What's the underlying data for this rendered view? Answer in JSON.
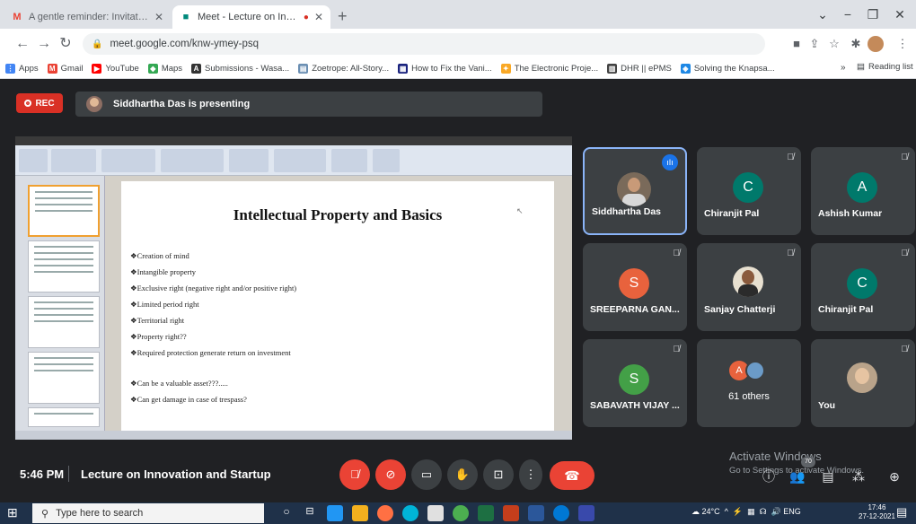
{
  "browser": {
    "tabs": [
      {
        "title": "A gentle reminder: Invitation for",
        "icon": "gmail-icon",
        "active": false
      },
      {
        "title": "Meet - Lecture on Innovation",
        "icon": "meet-icon",
        "active": true
      }
    ],
    "new_tab": "+",
    "address": "meet.google.com/knw-ymey-psq",
    "bookmarks": [
      {
        "label": "Apps",
        "color": "#4285f4"
      },
      {
        "label": "Gmail",
        "color": "#ea4335"
      },
      {
        "label": "YouTube",
        "color": "#ff0000"
      },
      {
        "label": "Maps",
        "color": "#34a853"
      },
      {
        "label": "Submissions - Wasa...",
        "color": "#333333"
      },
      {
        "label": "Zoetrope: All-Story...",
        "color": "#6b8fb3"
      },
      {
        "label": "How to Fix the Vani...",
        "color": "#1a237e"
      },
      {
        "label": "The Electronic Proje...",
        "color": "#f9a825"
      },
      {
        "label": "DHR || ePMS",
        "color": "#424242"
      },
      {
        "label": "Solving the Knapsa...",
        "color": "#1e88e5"
      }
    ],
    "reading_list": "Reading list"
  },
  "meet": {
    "rec_label": "REC",
    "presenting": "Siddhartha Das is presenting",
    "slide": {
      "title": "Intellectual Property and Basics",
      "bullets": [
        "❖Creation of mind",
        "❖Intangible property",
        "❖Exclusive right (negative right and/or positive right)",
        "❖Limited period right",
        "❖Territorial right",
        "❖Property right??",
        "❖Required protection generate return on investment",
        "",
        "❖Can be a valuable asset???.....",
        "❖Can get damage in case of trespass?"
      ]
    },
    "tiles": [
      {
        "name": "Siddhartha Das",
        "initial": "",
        "color": "#5f6368",
        "speaking": true
      },
      {
        "name": "Chiranjit Pal",
        "initial": "C",
        "color": "#00796b",
        "speaking": false
      },
      {
        "name": "Ashish Kumar",
        "initial": "A",
        "color": "#00796b",
        "speaking": false
      },
      {
        "name": "SREEPARNA GAN...",
        "initial": "S",
        "color": "#e8623d",
        "speaking": false
      },
      {
        "name": "Sanjay Chatterji",
        "initial": "",
        "color": "#5f6368",
        "speaking": false
      },
      {
        "name": "Chiranjit Pal",
        "initial": "C",
        "color": "#00796b",
        "speaking": false
      },
      {
        "name": "SABAVATH VIJAY ...",
        "initial": "S",
        "color": "#43a047",
        "speaking": false
      },
      {
        "name": "61 others",
        "initial": "A",
        "color": "#e8623d",
        "speaking": false
      },
      {
        "name": "You",
        "initial": "",
        "color": "#5f6368",
        "speaking": false
      }
    ],
    "time": "5:46 PM",
    "meeting_name": "Lecture on Innovation and Startup",
    "people_count": "70",
    "activate_title": "Activate Windows",
    "activate_sub": "Go to Settings to activate Windows."
  },
  "taskbar": {
    "search_placeholder": "Type here to search",
    "temperature": "24°C",
    "lang": "ENG",
    "clock_time": "17:46",
    "clock_date": "27-12-2021"
  }
}
